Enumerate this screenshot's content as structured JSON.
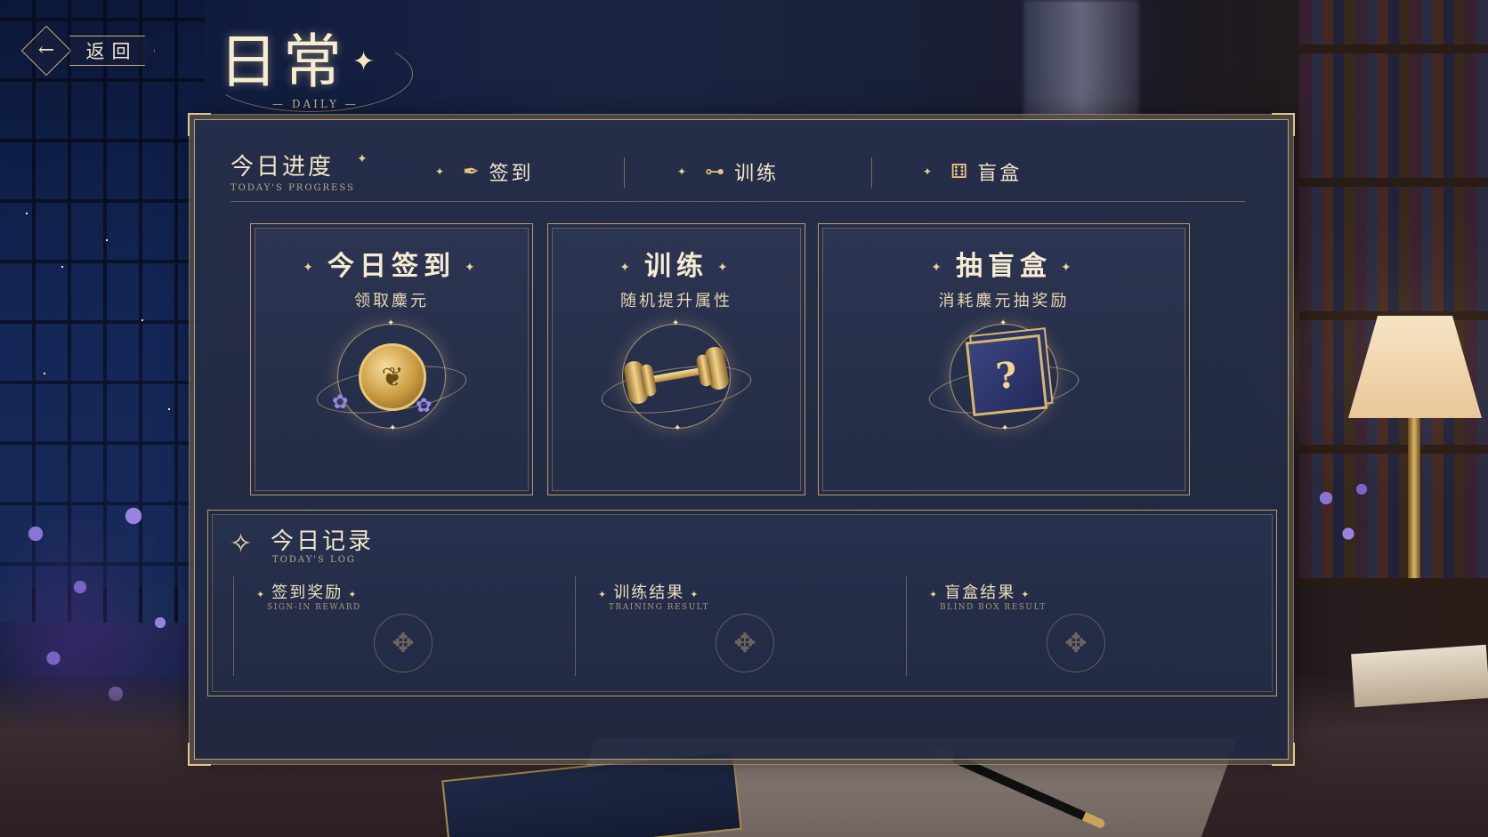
{
  "header": {
    "back_label": "返回",
    "back_icon": "arrow-left-icon",
    "title": "日常",
    "title_sub": "DAILY"
  },
  "tabs_bar": {
    "progress_title": "今日进度",
    "progress_title_en": "TODAY'S PROGRESS",
    "tabs": [
      {
        "label": "签到",
        "icon": "quill-pen-icon"
      },
      {
        "label": "训练",
        "icon": "dumbbell-icon"
      },
      {
        "label": "盲盒",
        "icon": "dice-box-icon"
      }
    ]
  },
  "cards": [
    {
      "title": "今日签到",
      "subtitle": "领取麋元",
      "icon": "leaf-coin-icon"
    },
    {
      "title": "训练",
      "subtitle": "随机提升属性",
      "icon": "dumbbell-icon"
    },
    {
      "title": "抽盲盒",
      "subtitle": "消耗麋元抽奖励",
      "icon": "mystery-box-icon"
    }
  ],
  "log": {
    "title": "今日记录",
    "title_en": "TODAY'S LOG",
    "columns": [
      {
        "label": "签到奖励",
        "label_en": "SIGN-IN REWARD"
      },
      {
        "label": "训练结果",
        "label_en": "TRAINING RESULT"
      },
      {
        "label": "盲盒结果",
        "label_en": "BLIND BOX RESULT"
      }
    ]
  },
  "colors": {
    "gold_accent": "#cdb07a",
    "panel_bg": "#262e4a",
    "text_cream": "#f3e6c8"
  }
}
